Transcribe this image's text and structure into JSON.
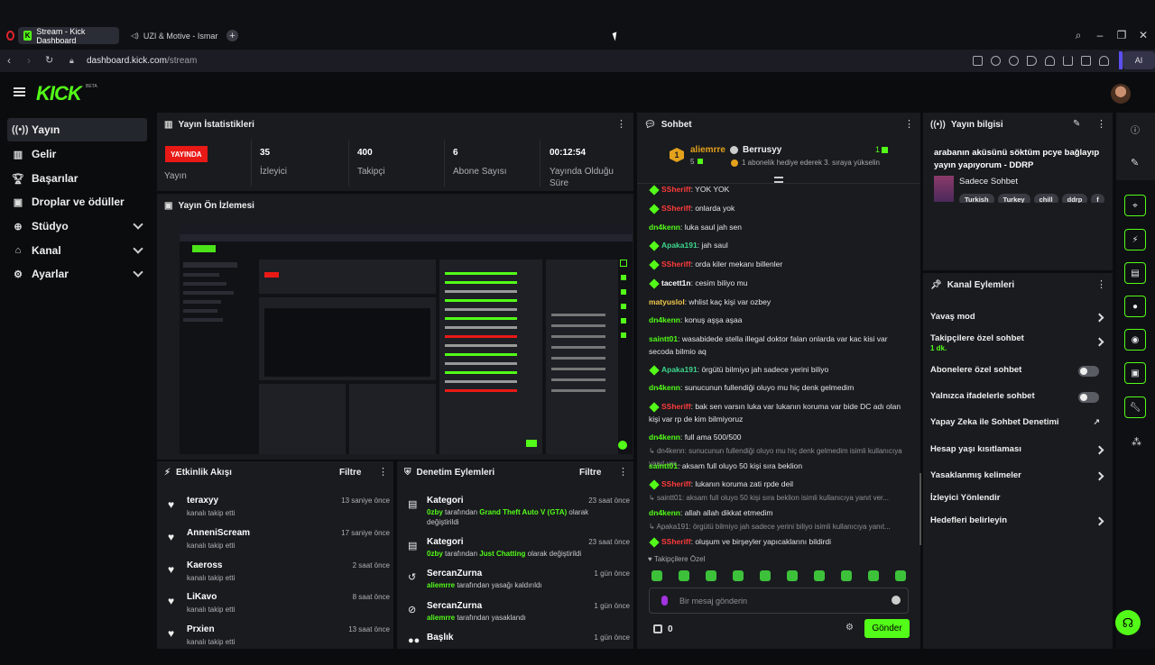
{
  "browser": {
    "tabs": [
      {
        "label": "Stream - Kick Dashboard"
      },
      {
        "label": "UZI & Motive - Ismar"
      }
    ],
    "url_domain": "dashboard.kick.com",
    "url_path": "/stream",
    "ai_label": "AI"
  },
  "header": {
    "logo": "KICK",
    "beta": "BETA"
  },
  "sidebar": {
    "items": [
      {
        "label": "Yayın",
        "icon": "broadcast-icon"
      },
      {
        "label": "Gelir",
        "icon": "revenue-icon"
      },
      {
        "label": "Başarılar",
        "icon": "trophy-icon"
      },
      {
        "label": "Droplar ve ödüller",
        "icon": "drops-icon"
      },
      {
        "label": "Stüdyo",
        "icon": "studio-icon"
      },
      {
        "label": "Kanal",
        "icon": "channel-icon"
      },
      {
        "label": "Ayarlar",
        "icon": "settings-icon"
      }
    ]
  },
  "stats": {
    "title": "Yayın İstatistikleri",
    "live_badge": "YAYINDA",
    "live_label": "Yayın",
    "viewers_value": "35",
    "viewers_label": "İzleyici",
    "followers_value": "400",
    "followers_label": "Takipçi",
    "subs_value": "6",
    "subs_label": "Abone Sayısı",
    "uptime_value": "00:12:54",
    "uptime_label": "Yayında Olduğu Süre"
  },
  "preview": {
    "title": "Yayın Ön İzlemesi"
  },
  "activity": {
    "title": "Etkinlik Akışı",
    "filter": "Filtre",
    "items": [
      {
        "name": "teraxyy",
        "action": "kanalı takip etti",
        "time": "13 saniye önce"
      },
      {
        "name": "AnneniScream",
        "action": "kanalı takip etti",
        "time": "17 saniye önce"
      },
      {
        "name": "Kaeross",
        "action": "kanalı takip etti",
        "time": "2 saat önce"
      },
      {
        "name": "LiKavo",
        "action": "kanalı takip etti",
        "time": "8 saat önce"
      },
      {
        "name": "Prxien",
        "action": "kanalı takip etti",
        "time": "13 saat önce"
      }
    ]
  },
  "moderation": {
    "title": "Denetim Eylemleri",
    "filter": "Filtre",
    "items": [
      {
        "name": "Kategori",
        "user": "0zby",
        "mid": " tarafından ",
        "highlight": "Grand Theft Auto V (GTA)",
        "rest": " olarak değiştirildi",
        "time": "23 saat önce"
      },
      {
        "name": "Kategori",
        "user": "0zby",
        "mid": " tarafından ",
        "highlight": "Just Chatting",
        "rest": " olarak değiştirildi",
        "time": "23 saat önce"
      },
      {
        "name": "SercanZurna",
        "user": "aliemrre",
        "mid": "",
        "highlight": "",
        "rest": " tarafından yasağı kaldırıldı",
        "time": "1 gün önce"
      },
      {
        "name": "SercanZurna",
        "user": "aliemrre",
        "mid": "",
        "highlight": "",
        "rest": " tarafından yasaklandı",
        "time": "1 gün önce"
      },
      {
        "name": "Başlık",
        "user": "",
        "mid": "",
        "highlight": "",
        "rest": "",
        "time": "1 gün önce"
      }
    ]
  },
  "chat": {
    "title": "Sohbet",
    "pinned_user": "aliemrre",
    "pinned_rank": "1",
    "pinned_count": "5",
    "pinned_gifter": "Berrusyy",
    "pinned_gift_count": "1",
    "pinned_note": "1 abonelik hediye ederek 3. sıraya yükselin",
    "messages": [
      {
        "user": "SSheriff",
        "color": "#ff3b3b",
        "badge": true,
        "text": "YOK YOK"
      },
      {
        "user": "SSheriff",
        "color": "#ff3b3b",
        "badge": true,
        "text": "onlarda yok"
      },
      {
        "user": "dn4kenn",
        "color": "#53fc18",
        "badge": false,
        "text": "luka saul jah sen"
      },
      {
        "user": "Apaka191",
        "color": "#3dd68c",
        "badge": true,
        "text": "jah saul"
      },
      {
        "user": "SSheriff",
        "color": "#ff3b3b",
        "badge": true,
        "text": "orda kiler mekanı billenler"
      },
      {
        "user": "tacett1n",
        "color": "#ffffff",
        "badge": true,
        "text": "cesim biliyo mu"
      },
      {
        "user": "matyuslol",
        "color": "#f2c94c",
        "badge": false,
        "text": "whlist kaç kişi var ozbey"
      },
      {
        "user": "dn4kenn",
        "color": "#53fc18",
        "badge": false,
        "text": "konuş aşşa aşaa"
      },
      {
        "user": "saintt01",
        "color": "#53fc18",
        "badge": false,
        "text": "wasabidede stella illegal doktor falan onlarda var kac kisi var secoda bilmio aq"
      },
      {
        "user": "Apaka191",
        "color": "#3dd68c",
        "badge": true,
        "text": "örgütü bilmiyo jah sadece yerini biliyo"
      },
      {
        "user": "dn4kenn",
        "color": "#53fc18",
        "badge": false,
        "text": "sunucunun fullendiği oluyo mu hiç denk gelmedim"
      },
      {
        "user": "SSheriff",
        "color": "#ff3b3b",
        "badge": true,
        "text": "bak sen varsın luka var lukanın koruma var bide DC adı olan kişi var rp de kim bilmiyoruz"
      },
      {
        "user": "dn4kenn",
        "color": "#53fc18",
        "badge": false,
        "text": "full ama 500/500"
      },
      {
        "reply": "dn4kenn: sunucunun fullendiği oluyo mu hiç denk gelmedim isimli kullanıcıya yanıt ver..."
      },
      {
        "user": "saintt01",
        "color": "#53fc18",
        "badge": false,
        "text": "aksam full oluyo 50 kişi sıra beklion"
      },
      {
        "user": "SSheriff",
        "color": "#ff3b3b",
        "badge": true,
        "text": "lukanın koruma zati rpde deil"
      },
      {
        "reply": "saintt01: aksam full oluyo 50 kişi sıra beklion isimli kullanıcıya yanıt ver..."
      },
      {
        "user": "dn4kenn",
        "color": "#53fc18",
        "badge": false,
        "text": "allah allah dikkat etmedim"
      },
      {
        "reply": "Apaka191: örgütü bilmiyo jah sadece yerini biliyo isimli kullanıcıya yanıt..."
      },
      {
        "user": "SSheriff",
        "color": "#ff3b3b",
        "badge": true,
        "text": "oluşum ve birşeyler yapıcaklarını bildirdi"
      }
    ],
    "followers_only": "Takipçilere Özel",
    "placeholder": "Bir mesaj gönderin",
    "points": "0",
    "send": "Gönder"
  },
  "stream_info": {
    "title": "Yayın bilgisi",
    "stream_title": "arabanın aküsünü söktüm pcye bağlayıp yayın yapıyorum - DDRP",
    "category": "Sadece Sohbet",
    "tags": [
      "Turkish",
      "Turkey",
      "chill",
      "ddrp",
      "f"
    ]
  },
  "channel_actions": {
    "title": "Kanal Eylemleri",
    "items": [
      {
        "label": "Yavaş mod",
        "control": "arrow"
      },
      {
        "label": "Takipçilere özel sohbet",
        "sub": "1 dk.",
        "control": "arrow"
      },
      {
        "label": "Abonelere özel sohbet",
        "control": "toggle"
      },
      {
        "label": "Yalnızca ifadelerle sohbet",
        "control": "toggle"
      },
      {
        "label": "Yapay Zeka ile Sohbet Denetimi",
        "control": "external"
      },
      {
        "label": "Hesap yaşı kısıtlaması",
        "control": "arrow"
      },
      {
        "label": "Yasaklanmış kelimeler",
        "control": "arrow"
      },
      {
        "label": "İzleyici Yönlendir",
        "control": "none"
      },
      {
        "label": "Hedefleri belirleyin",
        "control": "arrow"
      }
    ]
  },
  "colors": {
    "accent": "#53fc18",
    "live": "#e91916",
    "panel": "#191b1f",
    "bg": "#0b0c0e"
  }
}
